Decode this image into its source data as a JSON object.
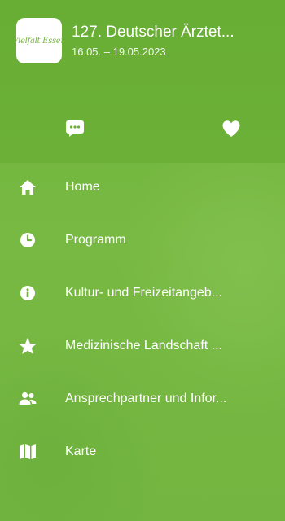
{
  "header": {
    "logo_text": "Vielfalt Essen",
    "title": "127. Deutscher Ärztet...",
    "dates": "16.05. – 19.05.2023"
  },
  "actions": [
    {
      "icon": "chat-bubble-icon"
    },
    {
      "icon": "heart-icon"
    }
  ],
  "menu": {
    "items": [
      {
        "label": "Home",
        "icon": "home-icon"
      },
      {
        "label": "Programm",
        "icon": "clock-icon"
      },
      {
        "label": "Kultur- und Freizeitangeb...",
        "icon": "info-icon"
      },
      {
        "label": "Medizinische Landschaft ...",
        "icon": "star-icon"
      },
      {
        "label": "Ansprechpartner und Infor...",
        "icon": "people-icon"
      },
      {
        "label": "Karte",
        "icon": "map-icon"
      }
    ]
  },
  "colors": {
    "background": "#74b53e",
    "header_background": "#6aaf36",
    "text": "#ffffff"
  }
}
